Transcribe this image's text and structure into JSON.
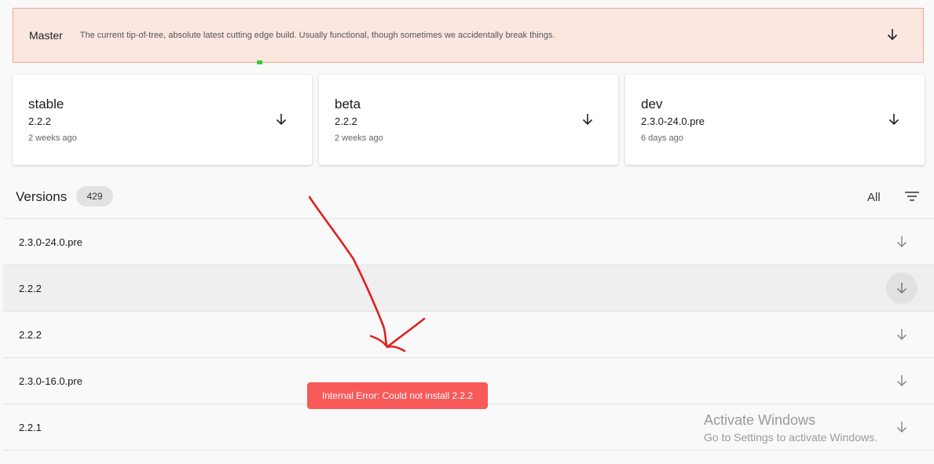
{
  "master": {
    "name": "Master",
    "description": "The current tip-of-tree, absolute latest cutting edge build. Usually functional, though sometimes we accidentally break things.",
    "icon": "download-icon"
  },
  "channels": [
    {
      "name": "stable",
      "version": "2.2.2",
      "when": "2 weeks ago",
      "icon": "download-icon"
    },
    {
      "name": "beta",
      "version": "2.2.2",
      "when": "2 weeks ago",
      "icon": "download-icon"
    },
    {
      "name": "dev",
      "version": "2.3.0-24.0.pre",
      "when": "6 days ago",
      "icon": "download-icon"
    }
  ],
  "versions": {
    "title": "Versions",
    "count": "429",
    "filter_label": "All",
    "filter_icon": "filter-icon",
    "rows": [
      {
        "version": "2.3.0-24.0.pre"
      },
      {
        "version": "2.2.2"
      },
      {
        "version": "2.2.2"
      },
      {
        "version": "2.3.0-16.0.pre"
      },
      {
        "version": "2.2.1"
      }
    ]
  },
  "toast": {
    "message": "Internal Error: Could not install 2.2.2",
    "color": "#f85959"
  },
  "watermark": {
    "line1": "Activate Windows",
    "line2": "Go to Settings to activate Windows."
  },
  "colors": {
    "master_bg": "#fbe7e0",
    "master_border": "#f0a58d",
    "annotation": "#e02020"
  }
}
